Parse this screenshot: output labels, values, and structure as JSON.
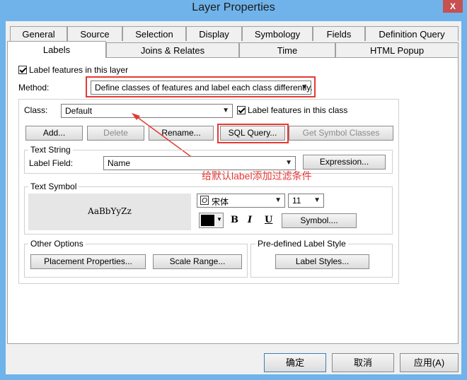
{
  "window": {
    "title": "Layer Properties",
    "close": "X"
  },
  "tabs_row1": [
    "General",
    "Source",
    "Selection",
    "Display",
    "Symbology",
    "Fields",
    "Definition Query"
  ],
  "tabs_row2": [
    "Labels",
    "Joins & Relates",
    "Time",
    "HTML Popup"
  ],
  "labels_tab": {
    "label_features_layer": "Label features in this layer",
    "method_label": "Method:",
    "method_value": "Define classes of features and label each class differently.",
    "class_label": "Class:",
    "class_value": "Default",
    "label_features_class": "Label features in this class",
    "buttons": {
      "add": "Add...",
      "delete": "Delete",
      "rename": "Rename...",
      "sql_query": "SQL Query...",
      "get_symbol_classes": "Get Symbol Classes"
    },
    "text_string": {
      "group": "Text String",
      "field_label": "Label Field:",
      "field_value": "Name",
      "expression": "Expression..."
    },
    "annotation": "给默认label添加过滤条件",
    "text_symbol": {
      "group": "Text Symbol",
      "preview": "AaBbYyZz",
      "font": "宋体",
      "size": "11",
      "bold": "B",
      "italic": "I",
      "underline": "U",
      "symbol": "Symbol...."
    },
    "other_options": {
      "group": "Other Options",
      "placement": "Placement Properties...",
      "scale": "Scale Range..."
    },
    "predefined": {
      "group": "Pre-defined Label Style",
      "styles": "Label Styles..."
    }
  },
  "footer": {
    "ok": "确定",
    "cancel": "取消",
    "apply": "应用(A)"
  }
}
